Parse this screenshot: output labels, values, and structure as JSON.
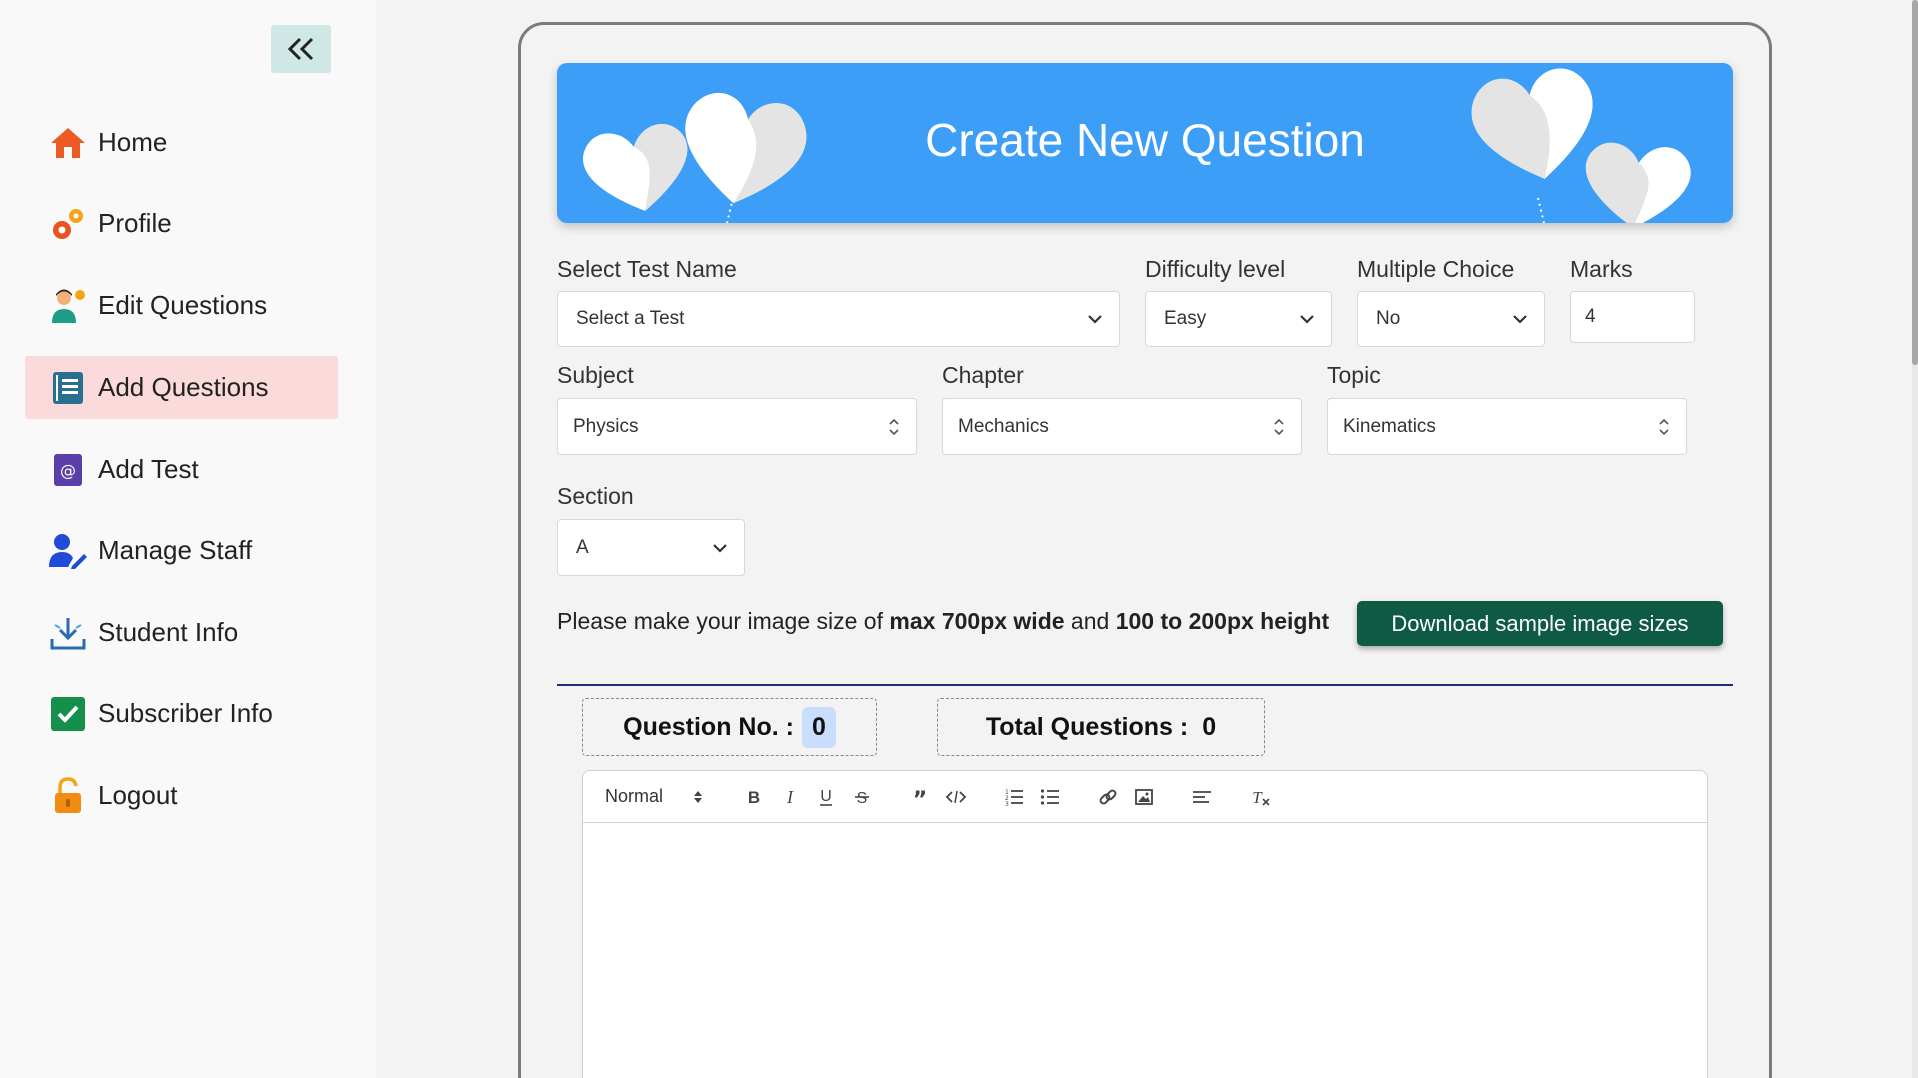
{
  "sidebar": {
    "collapse_icon": "double-chevron-left-icon",
    "items": [
      {
        "label": "Home",
        "icon": "home-icon"
      },
      {
        "label": "Profile",
        "icon": "gears-icon"
      },
      {
        "label": "Edit Questions",
        "icon": "user-edit-icon"
      },
      {
        "label": "Add Questions",
        "icon": "notebook-icon",
        "active": true
      },
      {
        "label": "Add Test",
        "icon": "at-book-icon"
      },
      {
        "label": "Manage Staff",
        "icon": "user-pen-icon"
      },
      {
        "label": "Student Info",
        "icon": "download-tray-icon"
      },
      {
        "label": "Subscriber Info",
        "icon": "checkbox-icon"
      },
      {
        "label": "Logout",
        "icon": "lock-open-icon"
      }
    ]
  },
  "banner": {
    "title": "Create New Question"
  },
  "form": {
    "test_name": {
      "label": "Select Test Name",
      "value": "Select a Test"
    },
    "difficulty": {
      "label": "Difficulty level",
      "value": "Easy"
    },
    "multiple_choice": {
      "label": "Multiple Choice",
      "value": "No"
    },
    "marks": {
      "label": "Marks",
      "value": "4"
    },
    "subject": {
      "label": "Subject",
      "value": "Physics"
    },
    "chapter": {
      "label": "Chapter",
      "value": "Mechanics"
    },
    "topic": {
      "label": "Topic",
      "value": "Kinematics"
    },
    "section": {
      "label": "Section",
      "value": "A"
    }
  },
  "note": {
    "prefix": "Please make your image size of ",
    "bold1": "max 700px wide",
    "middle": " and ",
    "bold2": "100 to 200px height"
  },
  "download_button": "Download sample image sizes",
  "counters": {
    "question_no_label": "Question No. :",
    "question_no_value": "0",
    "total_label": "Total Questions :",
    "total_value": "0"
  },
  "editor": {
    "format_select": "Normal",
    "tools": [
      "bold-icon",
      "italic-icon",
      "underline-icon",
      "strike-icon",
      "blockquote-icon",
      "code-block-icon",
      "ordered-list-icon",
      "bullet-list-icon",
      "link-icon",
      "image-icon",
      "align-icon",
      "clean-format-icon"
    ]
  },
  "colors": {
    "banner": "#3c9ef7",
    "active_nav": "#fadadb",
    "download_button": "#0f5a45",
    "collapse_button": "#cfe8e6"
  }
}
